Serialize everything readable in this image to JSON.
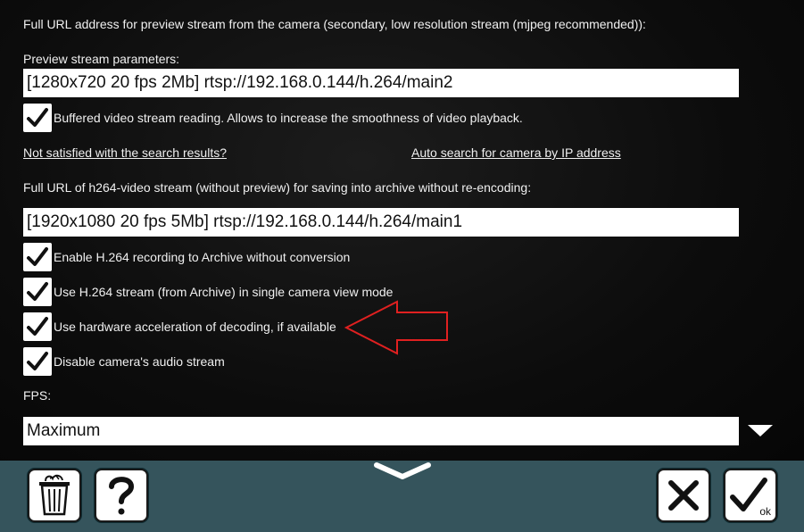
{
  "preview_url_heading": "Full URL address for preview stream from the camera (secondary, low resolution stream (mjpeg recommended)):",
  "preview_params_label": "Preview stream parameters:",
  "preview_stream_value": "[1280x720 20 fps 2Mb] rtsp://192.168.0.144/h.264/main2",
  "buffered_reading": {
    "label": "Buffered video stream reading. Allows to increase the smoothness of video playback.",
    "checked": true
  },
  "links": {
    "not_satisfied": "Not satisfied with the search results?",
    "auto_search": "Auto search for camera by IP address"
  },
  "h264_heading": "Full URL of h264-video stream (without preview) for saving into archive without re-encoding:",
  "h264_stream_value": "[1920x1080 20 fps 5Mb] rtsp://192.168.0.144/h.264/main1",
  "options": [
    {
      "label": "Enable H.264 recording to Archive without conversion",
      "checked": true
    },
    {
      "label": "Use H.264 stream (from Archive) in single camera view mode",
      "checked": true
    },
    {
      "label": "Use hardware acceleration of decoding, if available",
      "checked": true
    },
    {
      "label": "Disable camera's audio stream",
      "checked": true
    }
  ],
  "fps_label": "FPS:",
  "fps_value": "Maximum",
  "toolbar": {
    "ok_label": "ok"
  },
  "icons": {
    "delete": "trash-icon",
    "help": "question-icon",
    "collapse": "chevron-down-icon",
    "cancel": "close-icon",
    "confirm": "checkmark-icon",
    "annotation": "red-arrow-icon"
  },
  "colors": {
    "bottom_bar": "#35545c",
    "annotation_arrow": "#e02020",
    "field_bg": "#ffffff"
  }
}
